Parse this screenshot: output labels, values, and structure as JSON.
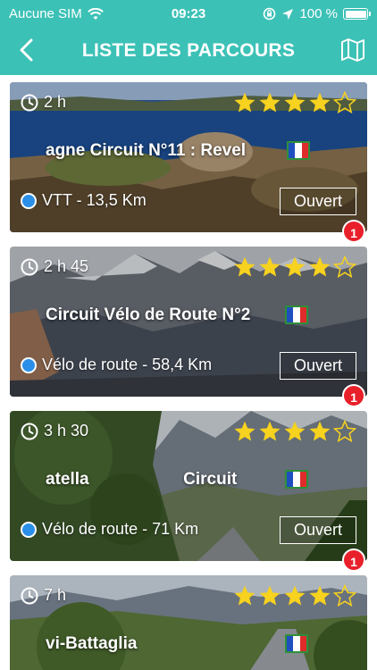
{
  "status_bar": {
    "carrier": "Aucune SIM",
    "time": "09:23",
    "battery": "100 %"
  },
  "header": {
    "title": "LISTE DES PARCOURS"
  },
  "routes": [
    {
      "duration": "2 h",
      "name": "agne Circuit N°11 : Revel",
      "type": "VTT - 13,5 Km",
      "status": "Ouvert",
      "badge": "1",
      "rating": 4
    },
    {
      "duration": "2 h 45",
      "name": "Circuit Vélo de Route N°2",
      "type": "Vélo de route - 58,4 Km",
      "status": "Ouvert",
      "badge": "1",
      "rating": 4
    },
    {
      "duration": "3 h 30",
      "name": "atella                    Circuit",
      "type": "Vélo de route - 71 Km",
      "status": "Ouvert",
      "badge": "1",
      "rating": 4
    },
    {
      "duration": "7 h",
      "name": "vi-Battaglia",
      "rating": 4
    }
  ],
  "colors": {
    "accent": "#3cc1b6",
    "star": "#f7d21e",
    "badge": "#e8202a",
    "type_dot": "#2a8fe8"
  }
}
